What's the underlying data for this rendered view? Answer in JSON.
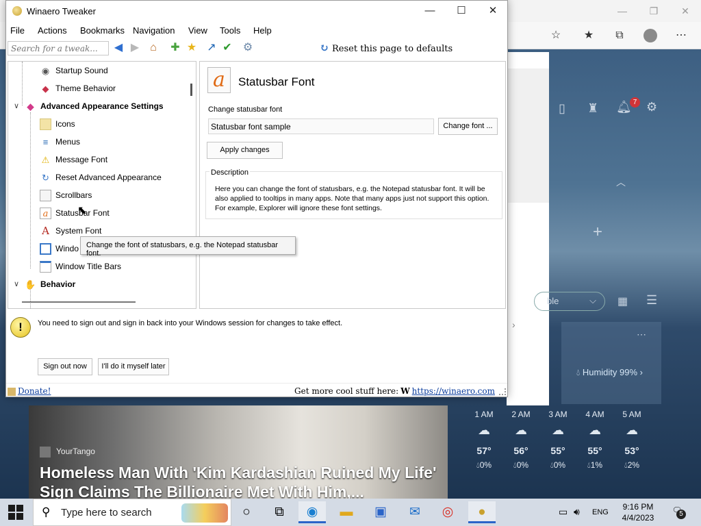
{
  "window": {
    "title": "Winaero Tweaker",
    "minimize": "—",
    "maximize": "☐",
    "close": "✕"
  },
  "menu": [
    "File",
    "Actions",
    "Bookmarks",
    "Navigation",
    "View",
    "Tools",
    "Help"
  ],
  "toolbar": {
    "search_placeholder": "Search for a tweak...",
    "reset_label": "Reset this page to defaults"
  },
  "tree": {
    "items": [
      {
        "label": "Startup Sound",
        "icon": "speaker-icon"
      },
      {
        "label": "Theme Behavior",
        "icon": "palette-icon"
      },
      {
        "label": "Advanced Appearance Settings",
        "icon": "appearance-icon",
        "category": true,
        "expanded": true
      },
      {
        "label": "Icons",
        "icon": "folder-icon"
      },
      {
        "label": "Menus",
        "icon": "menu-icon"
      },
      {
        "label": "Message Font",
        "icon": "warning-icon"
      },
      {
        "label": "Reset Advanced Appearance",
        "icon": "reset-icon"
      },
      {
        "label": "Scrollbars",
        "icon": "scrollbar-icon"
      },
      {
        "label": "Statusbar Font",
        "icon": "font-a-icon",
        "selected": true
      },
      {
        "label": "System Font",
        "icon": "font-big-a-icon"
      },
      {
        "label": "Window Borders",
        "icon": "window-icon"
      },
      {
        "label": "Window Title Bars",
        "icon": "titlebar-icon"
      },
      {
        "label": "Behavior",
        "icon": "behavior-icon",
        "category": true,
        "expanded": true
      }
    ],
    "tooltip": "Change the font of statusbars, e.g. the Notepad statusbar font.",
    "visible_labels": {
      "window_borders_visible": "Windo"
    }
  },
  "page": {
    "title": "Statusbar Font",
    "icon_letter": "a",
    "change_label": "Change statusbar font",
    "sample_value": "Statusbar font sample",
    "change_font_button": "Change font ...",
    "apply_button": "Apply changes",
    "description_label": "Description",
    "description": "Here you can change the font of statusbars, e.g. the Notepad statusbar font. It will be also applied to tooltips in many apps. Note that many apps just not support this option. For example, Explorer will ignore these font settings."
  },
  "notice": {
    "text": "You need to sign out and sign in back into your Windows session for changes to take effect.",
    "sign_out": "Sign out now",
    "later": "I'll do it myself later"
  },
  "status": {
    "donate": "Donate!",
    "more": "Get more cool stuff here:",
    "w_glyph": "W",
    "link": "https://winaero.com"
  },
  "edge": {
    "bell_count": "7",
    "dropdown_fragment": "ble",
    "humidity": "Humidity 99%",
    "hours": [
      {
        "time": "1 AM",
        "temp": "57°",
        "precip": "0%"
      },
      {
        "time": "2 AM",
        "temp": "56°",
        "precip": "0%"
      },
      {
        "time": "3 AM",
        "temp": "55°",
        "precip": "0%"
      },
      {
        "time": "4 AM",
        "temp": "55°",
        "precip": "1%"
      },
      {
        "time": "5 AM",
        "temp": "53°",
        "precip": "2%"
      }
    ],
    "news_source": "YourTango",
    "news_headline": "Homeless Man With 'Kim Kardashian Ruined My Life' Sign Claims The Billionaire Met With Him,..."
  },
  "taskbar": {
    "search_placeholder": "Type here to search",
    "language": "ENG",
    "time": "9:16 PM",
    "date": "4/4/2023",
    "notification_count": "5"
  },
  "colors": {
    "link": "#0a3c9c",
    "accent": "#2a64c8",
    "badge_red": "#d13438"
  }
}
